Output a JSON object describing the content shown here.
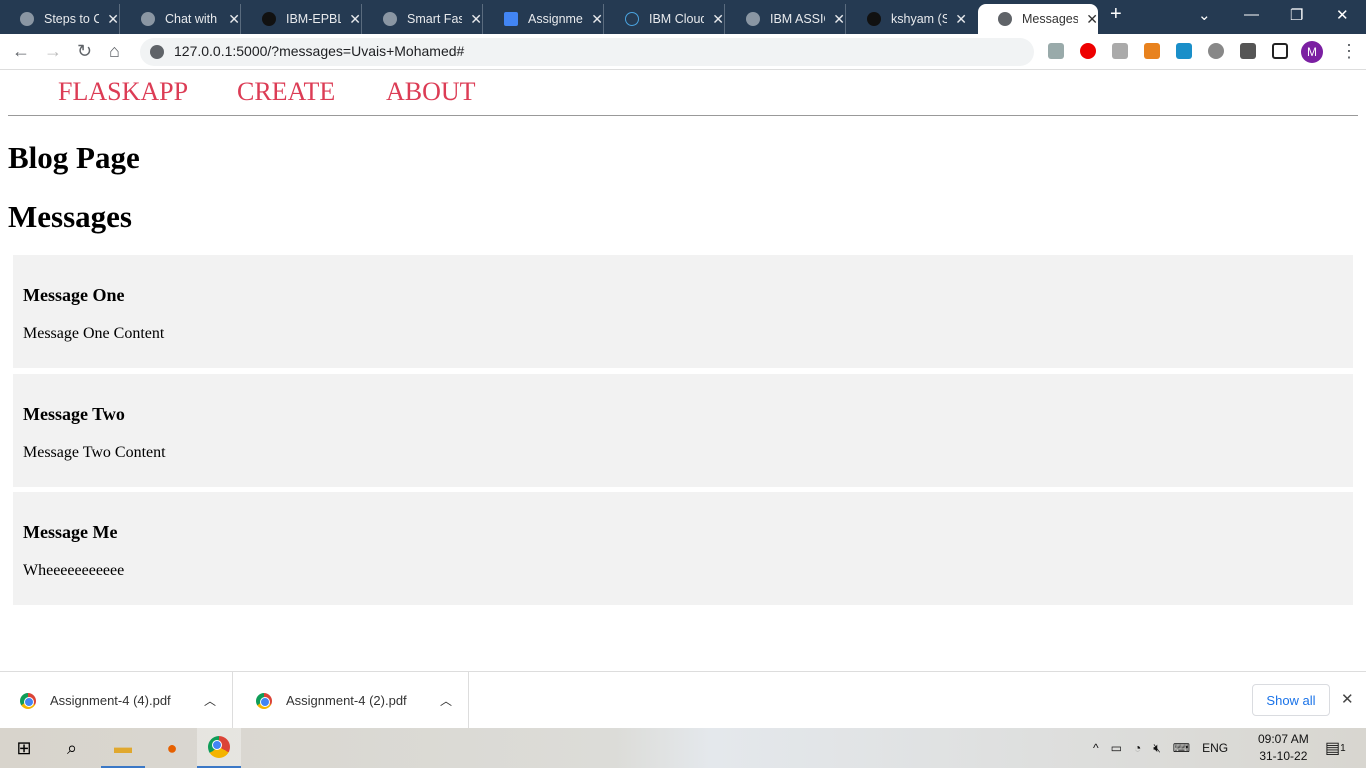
{
  "browser": {
    "tabs": [
      {
        "label": "Steps to Cr",
        "icon": "globe-icon"
      },
      {
        "label": "Chat with r",
        "icon": "globe-icon"
      },
      {
        "label": "IBM-EPBL/",
        "icon": "github-icon"
      },
      {
        "label": "Smart Fash",
        "icon": "globe-icon"
      },
      {
        "label": "Assignmen",
        "icon": "docs-icon"
      },
      {
        "label": "IBM Cloud",
        "icon": "ibm-cloud-icon"
      },
      {
        "label": "IBM ASSIG",
        "icon": "globe-icon"
      },
      {
        "label": "kshyam (Sh",
        "icon": "github-icon"
      },
      {
        "label": "Messages",
        "icon": "globe-icon",
        "active": true
      }
    ],
    "url": "127.0.0.1:5000/?messages=Uvais+Mohamed#",
    "profile_initial": "M"
  },
  "page": {
    "nav": [
      "FLASKAPP",
      "CREATE",
      "ABOUT"
    ],
    "title": "Blog Page",
    "section_title": "Messages",
    "messages": [
      {
        "title": "Message One",
        "content": "Message One Content"
      },
      {
        "title": "Message Two",
        "content": "Message Two Content"
      },
      {
        "title": "Message Me",
        "content": "Wheeeeeeeeeee"
      }
    ]
  },
  "downloads": {
    "items": [
      "Assignment-4 (4).pdf",
      "Assignment-4 (2).pdf"
    ],
    "show_all": "Show all"
  },
  "taskbar": {
    "lang": "ENG",
    "time": "09:07 AM",
    "date": "31-10-22",
    "notifications": "1"
  }
}
